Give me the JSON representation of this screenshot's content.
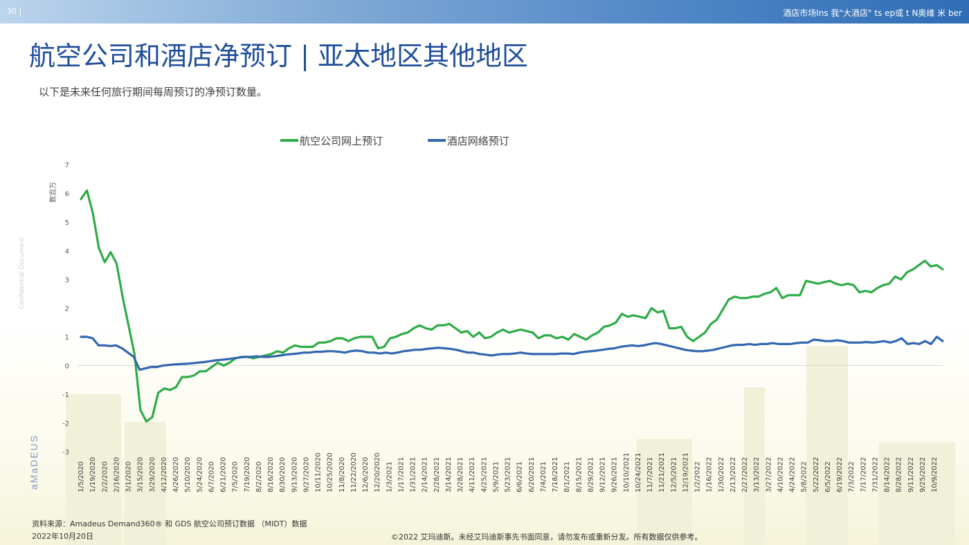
{
  "header": {
    "page_number": "30 |",
    "nav_text": "酒店市场Ins 我\"大酒店\" ts    ep或 t    N奥维 米 ber"
  },
  "title": "航空公司和酒店净预订 | 亚太地区其他地区",
  "subtitle": "以下是未来任何旅行期间每周预订的净预订数量。",
  "side_label": "Confidential Document",
  "brand": "aMaDEUS",
  "footer": {
    "source": "资料来源：Amadeus Demand360® 和 GDS 航空公司预订数据 （MIDT）数据",
    "date": "2022年10月20日",
    "copyright": "©2022 艾玛迪斯。未经艾玛迪斯事先书面同意，请勿发布或重新分发。所有数据仅供参考。"
  },
  "colors": {
    "airline": "#2eab47",
    "hotel": "#3266b0",
    "title": "#1f4e9a"
  },
  "chart_data": {
    "type": "line",
    "ylabel": "数百万",
    "ylim": [
      -3,
      7
    ],
    "yticks": [
      -3,
      -2,
      -1,
      0,
      1,
      2,
      3,
      4,
      5,
      6,
      7
    ],
    "legend": "top",
    "grid": false,
    "x_labels": [
      "1/5/2020",
      "1/19/2020",
      "2/2/2020",
      "2/16/2020",
      "3/1/2020",
      "3/15/2020",
      "3/29/2020",
      "4/12/2020",
      "4/26/2020",
      "5/10/2020",
      "5/24/2020",
      "6/7/2020",
      "6/21/2020",
      "7/5/2020",
      "7/19/2020",
      "8/2/2020",
      "8/16/2020",
      "8/30/2020",
      "9/13/2020",
      "9/27/2020",
      "10/11/2020",
      "10/25/2020",
      "11/8/2020",
      "11/22/2020",
      "12/6/2020",
      "12/20/2020",
      "1/3/2021",
      "1/17/2021",
      "1/31/2021",
      "2/14/2021",
      "2/28/2021",
      "3/14/2021",
      "3/28/2021",
      "4/11/2021",
      "4/25/2021",
      "5/9/2021",
      "5/23/2021",
      "6/6/2021",
      "6/20/2021",
      "7/4/2021",
      "7/18/2021",
      "8/1/2021",
      "8/15/2021",
      "8/29/2021",
      "9/12/2021",
      "9/26/2021",
      "10/10/2021",
      "10/24/2021",
      "11/7/2021",
      "11/21/2021",
      "12/5/2021",
      "12/19/2021",
      "1/2/2022",
      "1/16/2022",
      "1/30/2022",
      "2/13/2022",
      "2/27/2022",
      "3/13/2022",
      "3/27/2022",
      "4/10/2022",
      "4/24/2022",
      "5/8/2022",
      "5/22/2022",
      "6/5/2022",
      "6/19/2022",
      "7/3/2022",
      "7/17/2022",
      "7/31/2022",
      "8/14/2022",
      "8/28/2022",
      "9/11/2022",
      "9/25/2022",
      "10/9/2022"
    ],
    "series": [
      {
        "name": "航空公司网上预订",
        "color": "#2eab47",
        "values": [
          5.8,
          6.1,
          5.3,
          4.1,
          3.6,
          3.95,
          3.55,
          2.4,
          1.4,
          0.4,
          -1.55,
          -1.95,
          -1.8,
          -0.95,
          -0.8,
          -0.85,
          -0.75,
          -0.4,
          -0.4,
          -0.35,
          -0.2,
          -0.2,
          -0.05,
          0.1,
          0.0,
          0.1,
          0.25,
          0.3,
          0.3,
          0.25,
          0.3,
          0.35,
          0.4,
          0.5,
          0.45,
          0.6,
          0.7,
          0.65,
          0.65,
          0.65,
          0.8,
          0.8,
          0.85,
          0.95,
          0.95,
          0.85,
          0.95,
          1.0,
          1.0,
          1.0,
          0.6,
          0.65,
          0.95,
          1.0,
          1.1,
          1.15,
          1.3,
          1.4,
          1.3,
          1.25,
          1.4,
          1.4,
          1.45,
          1.3,
          1.15,
          1.2,
          1.0,
          1.15,
          0.95,
          1.0,
          1.15,
          1.25,
          1.15,
          1.2,
          1.25,
          1.2,
          1.15,
          0.95,
          1.05,
          1.05,
          0.95,
          1.0,
          0.9,
          1.1,
          1.0,
          0.9,
          1.05,
          1.15,
          1.35,
          1.4,
          1.5,
          1.8,
          1.7,
          1.75,
          1.7,
          1.65,
          2.0,
          1.85,
          1.9,
          1.3,
          1.3,
          1.35,
          1.0,
          0.85,
          1.0,
          1.15,
          1.45,
          1.6,
          1.95,
          2.3,
          2.4,
          2.35,
          2.35,
          2.4,
          2.4,
          2.5,
          2.55,
          2.7,
          2.35,
          2.45,
          2.45,
          2.45,
          2.95,
          2.9,
          2.85,
          2.9,
          2.95,
          2.85,
          2.8,
          2.85,
          2.8,
          2.55,
          2.6,
          2.55,
          2.7,
          2.8,
          2.85,
          3.1,
          3.0,
          3.25,
          3.35,
          3.5,
          3.65,
          3.45,
          3.5,
          3.35
        ]
      },
      {
        "name": "酒店网络预订",
        "color": "#3266b0",
        "values": [
          1.0,
          1.0,
          0.95,
          0.7,
          0.7,
          0.68,
          0.7,
          0.6,
          0.45,
          0.3,
          -0.15,
          -0.1,
          -0.05,
          -0.05,
          0.0,
          0.02,
          0.04,
          0.05,
          0.06,
          0.08,
          0.1,
          0.12,
          0.15,
          0.18,
          0.2,
          0.22,
          0.25,
          0.28,
          0.3,
          0.3,
          0.32,
          0.3,
          0.3,
          0.32,
          0.35,
          0.38,
          0.4,
          0.42,
          0.45,
          0.45,
          0.48,
          0.48,
          0.5,
          0.5,
          0.48,
          0.45,
          0.5,
          0.52,
          0.5,
          0.45,
          0.45,
          0.42,
          0.45,
          0.42,
          0.45,
          0.5,
          0.52,
          0.55,
          0.55,
          0.58,
          0.6,
          0.62,
          0.6,
          0.58,
          0.55,
          0.5,
          0.45,
          0.45,
          0.4,
          0.38,
          0.35,
          0.38,
          0.4,
          0.4,
          0.42,
          0.45,
          0.42,
          0.4,
          0.4,
          0.4,
          0.4,
          0.4,
          0.42,
          0.42,
          0.4,
          0.45,
          0.48,
          0.5,
          0.52,
          0.55,
          0.58,
          0.6,
          0.65,
          0.68,
          0.7,
          0.68,
          0.7,
          0.75,
          0.78,
          0.75,
          0.7,
          0.65,
          0.6,
          0.55,
          0.52,
          0.5,
          0.5,
          0.52,
          0.55,
          0.6,
          0.65,
          0.7,
          0.72,
          0.72,
          0.75,
          0.72,
          0.75,
          0.75,
          0.78,
          0.75,
          0.75,
          0.75,
          0.78,
          0.8,
          0.8,
          0.9,
          0.88,
          0.85,
          0.85,
          0.88,
          0.85,
          0.8,
          0.8,
          0.8,
          0.82,
          0.8,
          0.82,
          0.85,
          0.8,
          0.85,
          0.95,
          0.75,
          0.78,
          0.75,
          0.85,
          0.75,
          1.0,
          0.85
        ]
      }
    ]
  }
}
